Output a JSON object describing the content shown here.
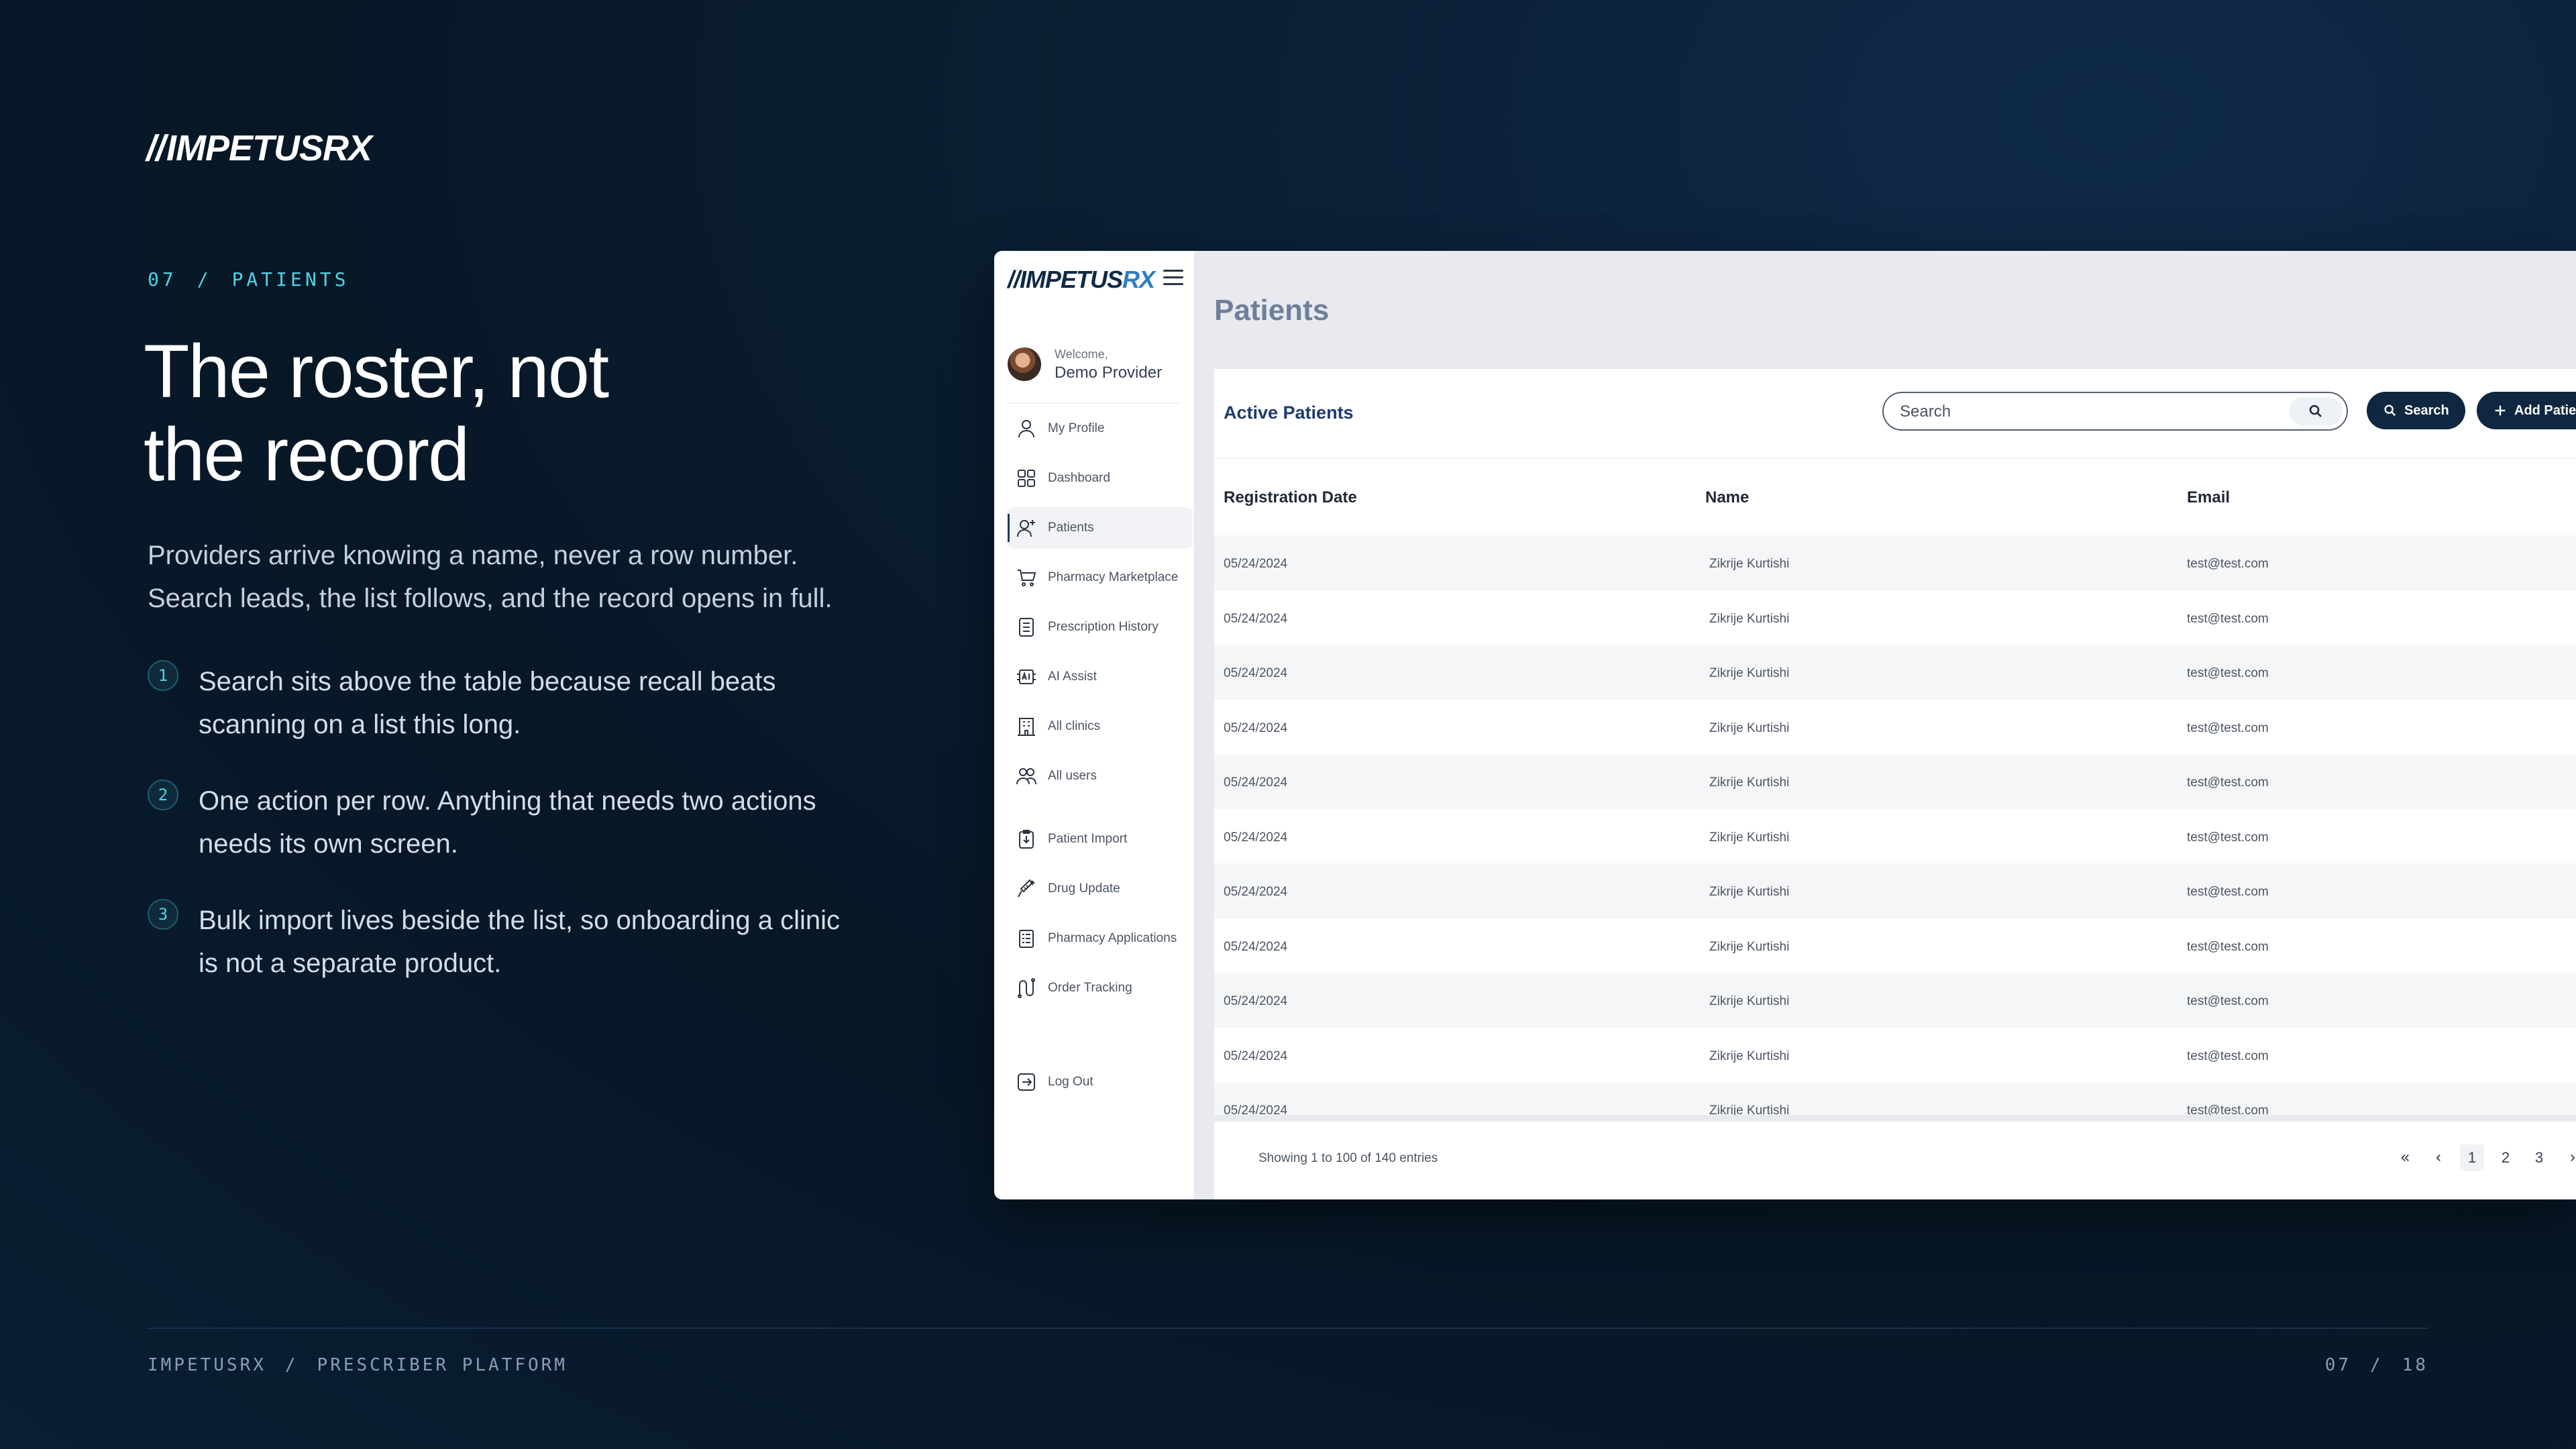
{
  "slide": {
    "brand": "IMPETUSRX",
    "kicker": {
      "num": "07",
      "sep": "/",
      "label": "PATIENTS"
    },
    "headline": [
      "The roster, not",
      "the record"
    ],
    "lede": [
      "Providers arrive knowing a name, never a row number.",
      "Search leads, the list follows, and the record opens in full."
    ],
    "points": [
      {
        "num": "1",
        "text": "Search sits above the table because recall beats scanning on a list this long."
      },
      {
        "num": "2",
        "text": "One action per row. Anything that needs two actions needs its own screen."
      },
      {
        "num": "3",
        "text": "Bulk import lives beside the list, so onboarding a clinic is not a separate product."
      }
    ],
    "footer": {
      "left_a": "IMPETUSRX",
      "sep": "/",
      "left_b": "PRESCRIBER PLATFORM",
      "page": "07",
      "total": "18"
    }
  },
  "app": {
    "logo_main": "IMPETUS",
    "logo_accent": "RX",
    "welcome_small": "Welcome,",
    "welcome_name": "Demo Provider",
    "nav": [
      {
        "label": "My Profile",
        "icon": "user-icon"
      },
      {
        "label": "Dashboard",
        "icon": "dashboard-icon"
      },
      {
        "label": "Patients",
        "icon": "user-plus-icon",
        "active": true
      },
      {
        "label": "Pharmacy Marketplace",
        "icon": "cart-icon"
      },
      {
        "label": "Prescription History",
        "icon": "document-list-icon"
      },
      {
        "label": "AI Assist",
        "icon": "ai-chip-icon"
      },
      {
        "label": "All  clinics",
        "icon": "building-icon"
      },
      {
        "label": "All users",
        "icon": "users-icon"
      },
      {
        "label": "Patient Import",
        "icon": "import-icon"
      },
      {
        "label": "Drug Update",
        "icon": "syringe-icon"
      },
      {
        "label": "Pharmacy Applications",
        "icon": "clipboard-icon"
      },
      {
        "label": "Order Tracking",
        "icon": "route-icon"
      },
      {
        "label": "Log Out",
        "icon": "logout-icon"
      }
    ],
    "page_title": "Patients",
    "card_title": "Active Patients",
    "search": {
      "placeholder": "Search",
      "button": "Search"
    },
    "add_button": "Add Patient",
    "columns": [
      "Registration Date",
      "Name",
      "Email"
    ],
    "rows": [
      [
        "05/24/2024",
        "Zikrije Kurtishi",
        "test@test.com"
      ],
      [
        "05/24/2024",
        "Zikrije Kurtishi",
        "test@test.com"
      ],
      [
        "05/24/2024",
        "Zikrije Kurtishi",
        "test@test.com"
      ],
      [
        "05/24/2024",
        "Zikrije Kurtishi",
        "test@test.com"
      ],
      [
        "05/24/2024",
        "Zikrije Kurtishi",
        "test@test.com"
      ],
      [
        "05/24/2024",
        "Zikrije Kurtishi",
        "test@test.com"
      ],
      [
        "05/24/2024",
        "Zikrije Kurtishi",
        "test@test.com"
      ],
      [
        "05/24/2024",
        "Zikrije Kurtishi",
        "test@test.com"
      ],
      [
        "05/24/2024",
        "Zikrije Kurtishi",
        "test@test.com"
      ],
      [
        "05/24/2024",
        "Zikrije Kurtishi",
        "test@test.com"
      ],
      [
        "05/24/2024",
        "Zikrije Kurtishi",
        "test@test.com"
      ]
    ],
    "showing": "Showing 1 to 100 of 140 entries",
    "pages": [
      "1",
      "2",
      "3"
    ],
    "current_page": "1"
  }
}
